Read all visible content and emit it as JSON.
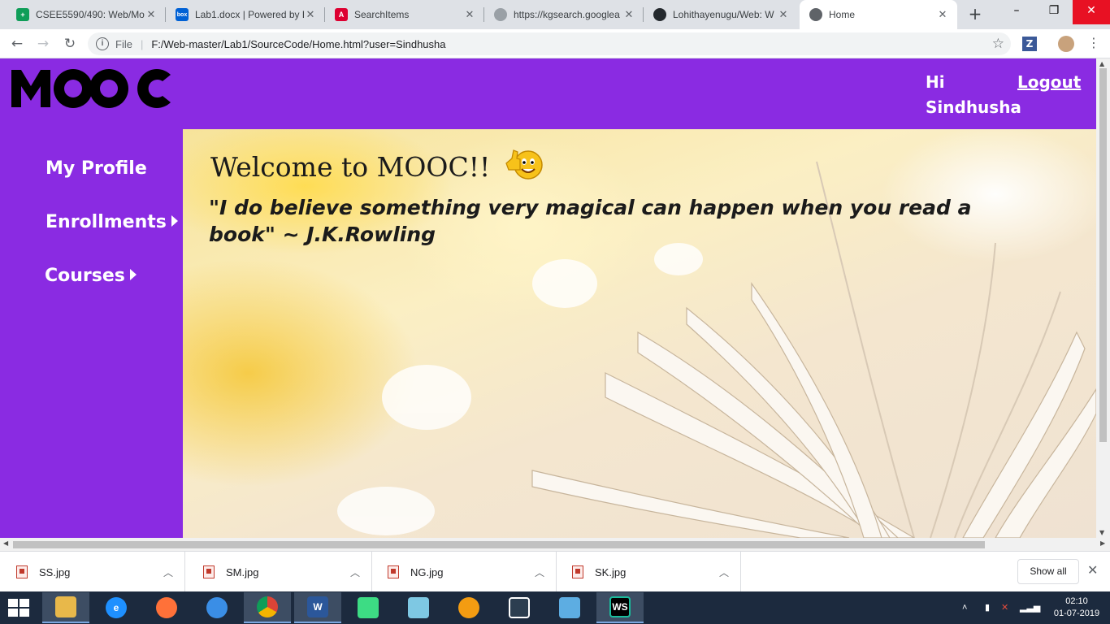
{
  "browser": {
    "tabs": [
      {
        "title": "CSEE5590/490: Web/Mo",
        "favicon": "google-sheets-icon",
        "color": "#0f9d58"
      },
      {
        "title": "Lab1.docx | Powered by B",
        "favicon": "box-icon",
        "color": "#0061d5"
      },
      {
        "title": "SearchItems",
        "favicon": "angular-icon",
        "color": "#dd0031"
      },
      {
        "title": "https://kgsearch.googlea",
        "favicon": "globe-icon",
        "color": "#9aa0a6"
      },
      {
        "title": "Lohithayenugu/Web: W",
        "favicon": "github-icon",
        "color": "#24292e"
      },
      {
        "title": "Home",
        "favicon": "globe-icon",
        "color": "#5f6368"
      }
    ],
    "active_tab": "Home",
    "address": {
      "scheme_label": "File",
      "url": "F:/Web-master/Lab1/SourceCode/Home.html?user=Sindhusha"
    }
  },
  "page": {
    "logo_text": "MOOC",
    "header": {
      "greeting": "Hi Sindhusha",
      "logout": "Logout"
    },
    "sidebar": {
      "items": [
        {
          "label": "My Profile",
          "has_submenu": false
        },
        {
          "label": "Enrollments",
          "has_submenu": true
        },
        {
          "label": "Courses",
          "has_submenu": true
        }
      ]
    },
    "main": {
      "welcome": "Welcome to MOOC!!",
      "quote": "\"I do believe something very magical can happen when you read a book\" ~ J.K.Rowling"
    },
    "colors": {
      "brand_purple": "#8a2be2"
    }
  },
  "downloads": {
    "items": [
      {
        "name": "SS.jpg"
      },
      {
        "name": "SM.jpg"
      },
      {
        "name": "NG.jpg"
      },
      {
        "name": "SK.jpg"
      }
    ],
    "show_all": "Show all"
  },
  "taskbar": {
    "apps": [
      "file-explorer-icon",
      "internet-explorer-icon",
      "firefox-icon",
      "app-icon",
      "chrome-icon",
      "word-icon",
      "android-studio-icon",
      "notepad-icon",
      "settings-icon",
      "bracket-icon",
      "network-icon",
      "webstorm-icon"
    ],
    "time": "02:10",
    "date": "01-07-2019"
  }
}
